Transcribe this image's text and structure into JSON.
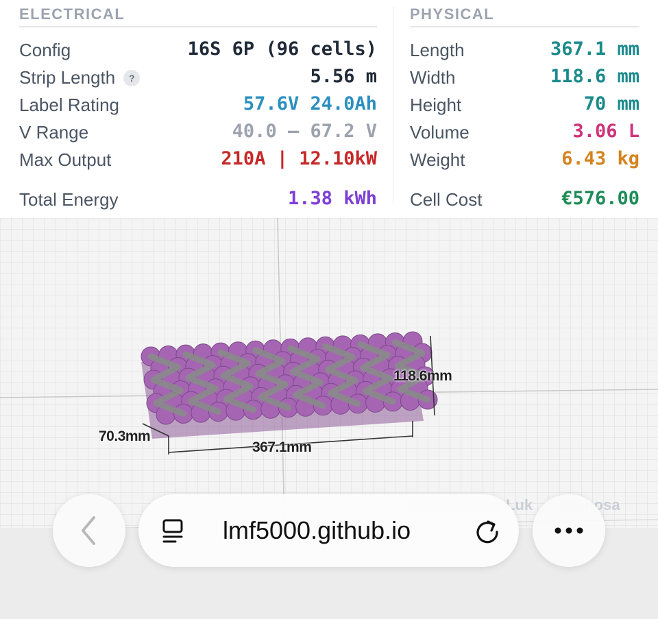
{
  "electrical": {
    "title": "ELECTRICAL",
    "config": {
      "label": "Config",
      "value": "16S 6P (96 cells)",
      "color": "#1f2937"
    },
    "strip_length": {
      "label": "Strip Length",
      "info": "?",
      "value": "5.56 m",
      "color": "#1f2937"
    },
    "label_rating": {
      "label": "Label Rating",
      "value": "57.6V 24.0Ah",
      "color": "#2b8fbf"
    },
    "v_range": {
      "label": "V Range",
      "value": "40.0 – 67.2 V",
      "color": "#9ca3af"
    },
    "max_output": {
      "label": "Max Output",
      "value": "210A | 12.10kW",
      "color": "#c62828"
    },
    "total_energy": {
      "label": "Total Energy",
      "value": "1.38 kWh",
      "color": "#7e3fd6"
    }
  },
  "physical": {
    "title": "PHYSICAL",
    "length": {
      "label": "Length",
      "value": "367.1 mm",
      "color": "#1b8a8c"
    },
    "width": {
      "label": "Width",
      "value": "118.6 mm",
      "color": "#1b8a8c"
    },
    "height": {
      "label": "Height",
      "value": "70 mm",
      "color": "#1b8a8c"
    },
    "volume": {
      "label": "Volume",
      "value": "3.06 L",
      "color": "#d0337a"
    },
    "weight": {
      "label": "Weight",
      "value": "6.43 kg",
      "color": "#d4831f"
    },
    "cell_cost": {
      "label": "Cell Cost",
      "value": "€576.00",
      "color": "#1e8c57"
    }
  },
  "viewer": {
    "dim_width": "118.6mm",
    "dim_height": "70.3mm",
    "dim_length": "367.1mm",
    "watermark": "Luk",
    "watermark_end": "mosa",
    "cell_color": "#a565b3",
    "strip_color": "#8a8a8a"
  },
  "browser": {
    "url": "lmf5000.github.io",
    "back_icon": "chevron-left-icon",
    "reader_icon": "reader-mode-icon",
    "reload_icon": "reload-icon",
    "more_icon": "more-dots-icon"
  }
}
